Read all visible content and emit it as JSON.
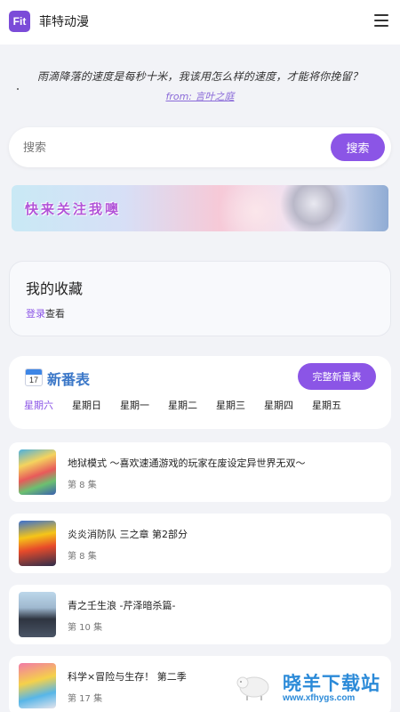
{
  "app": {
    "logo_text": "Fit",
    "title": "菲特动漫"
  },
  "quote": {
    "text": "雨滴降落的速度是每秒十米，我该用怎么样的速度，才能将你挽留？",
    "source": "from: 言叶之庭"
  },
  "search": {
    "placeholder": "搜索",
    "button_label": "搜索"
  },
  "banner": {
    "text": "快来关注我噢"
  },
  "favorites": {
    "title": "我的收藏",
    "login_link": "登录",
    "hint_suffix": "查看"
  },
  "schedule": {
    "title": "新番表",
    "calendar_day": "17",
    "full_button": "完整新番表",
    "days": [
      "星期六",
      "星期日",
      "星期一",
      "星期二",
      "星期三",
      "星期四",
      "星期五"
    ],
    "active_day": "星期六"
  },
  "anime_list": [
    {
      "name": "地狱模式 ～喜欢速通游戏的玩家在废设定异世界无双～",
      "episode": "第 8 集"
    },
    {
      "name": "炎炎消防队 三之章 第2部分",
      "episode": "第 8 集"
    },
    {
      "name": "青之壬生浪 -芹泽暗杀篇-",
      "episode": "第 10 集"
    },
    {
      "name": "科学×冒险与生存！ 第二季",
      "episode": "第 17 集"
    }
  ],
  "watermark": {
    "text": "晓羊下载站",
    "url": "www.xfhygs.com"
  },
  "colors": {
    "accent": "#8b55e6",
    "schedule_title": "#3c78c8",
    "watermark": "#2b8ad8"
  }
}
